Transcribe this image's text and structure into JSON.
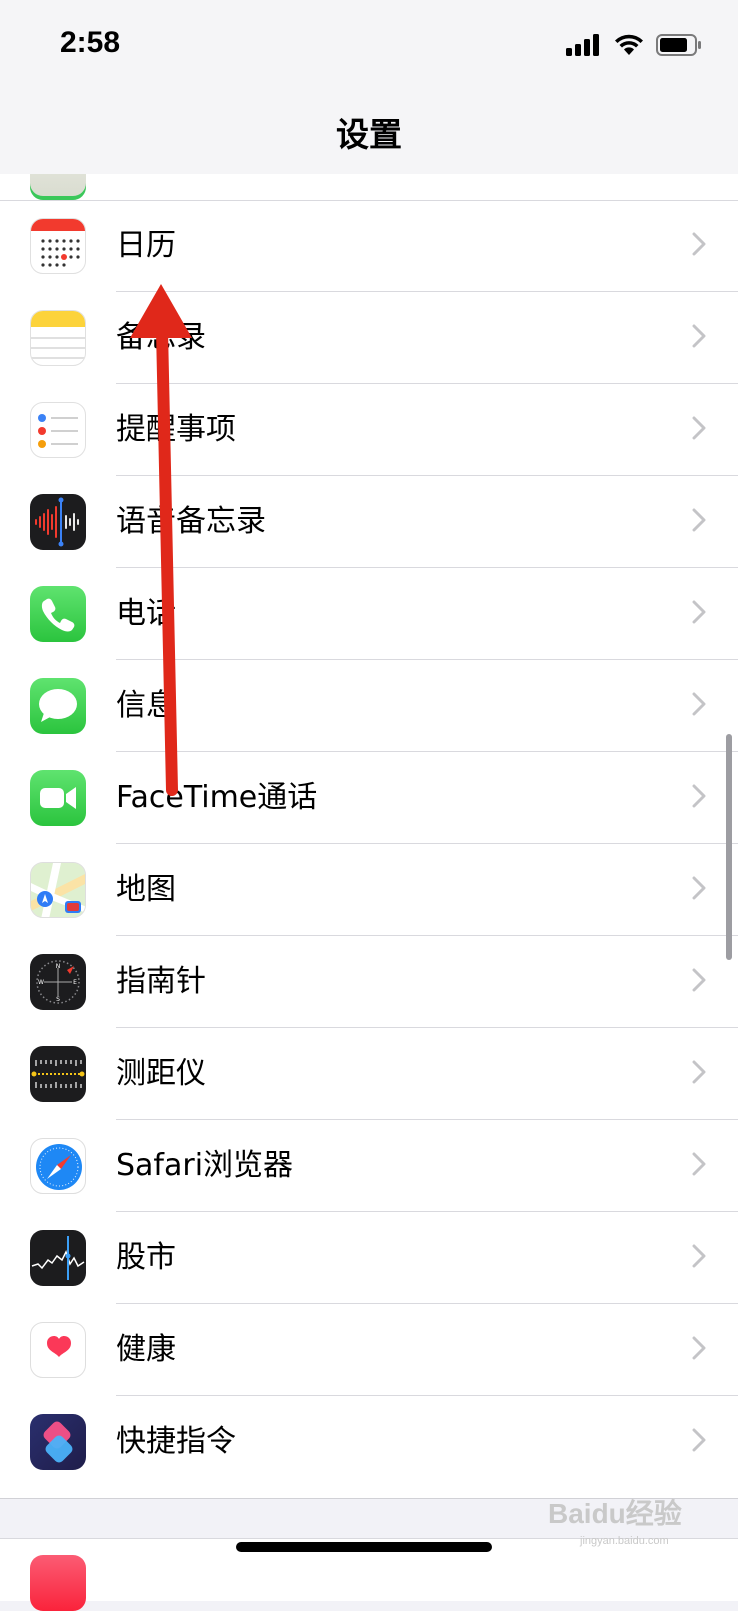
{
  "status_bar": {
    "time": "2:58",
    "icons": [
      "signal-icon",
      "wifi-icon",
      "battery-icon"
    ]
  },
  "nav": {
    "title": "设置"
  },
  "settings_items": [
    {
      "label": "日历",
      "icon": "calendar-icon"
    },
    {
      "label": "备忘录",
      "icon": "notes-icon"
    },
    {
      "label": "提醒事项",
      "icon": "reminders-icon"
    },
    {
      "label": "语音备忘录",
      "icon": "voice-memos-icon"
    },
    {
      "label": "电话",
      "icon": "phone-icon"
    },
    {
      "label": "信息",
      "icon": "messages-icon"
    },
    {
      "label": "FaceTime通话",
      "icon": "facetime-icon"
    },
    {
      "label": "地图",
      "icon": "maps-icon"
    },
    {
      "label": "指南针",
      "icon": "compass-icon"
    },
    {
      "label": "测距仪",
      "icon": "measure-icon"
    },
    {
      "label": "Safari浏览器",
      "icon": "safari-icon"
    },
    {
      "label": "股市",
      "icon": "stocks-icon"
    },
    {
      "label": "健康",
      "icon": "health-icon"
    },
    {
      "label": "快捷指令",
      "icon": "shortcuts-icon"
    }
  ],
  "bottom_peek": {
    "label": "",
    "icon": "music-icon"
  },
  "watermark": {
    "text": "Baidu经验",
    "sub": "jingyan.baidu.com"
  },
  "colors": {
    "annotation_arrow": "#e0281a",
    "chevron": "#c4c4c7",
    "background": "#f2f2f7"
  }
}
